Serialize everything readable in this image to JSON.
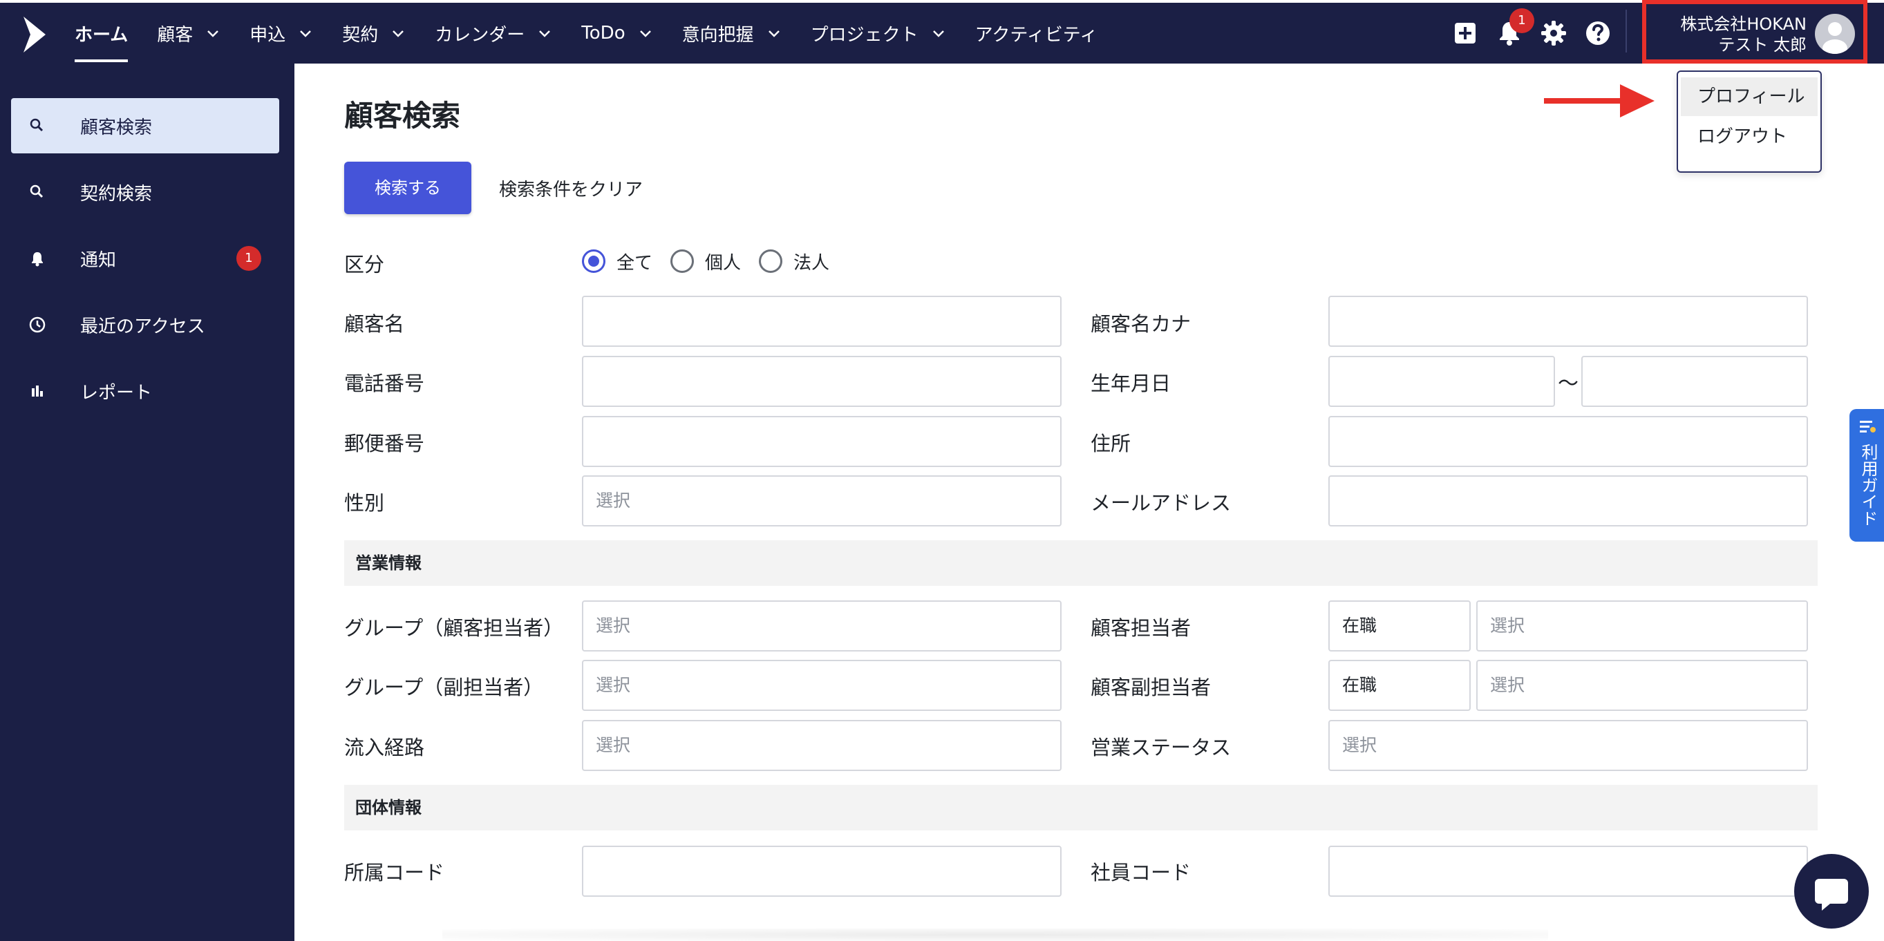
{
  "topbar": {
    "nav": [
      {
        "label": "ホーム",
        "active": true,
        "has_menu": false
      },
      {
        "label": "顧客",
        "has_menu": true
      },
      {
        "label": "申込",
        "has_menu": true
      },
      {
        "label": "契約",
        "has_menu": true
      },
      {
        "label": "カレンダー",
        "has_menu": true
      },
      {
        "label": "ToDo",
        "has_menu": true
      },
      {
        "label": "意向把握",
        "has_menu": true
      },
      {
        "label": "プロジェクト",
        "has_menu": true
      },
      {
        "label": "アクティビティ",
        "has_menu": false
      }
    ],
    "notification_count": "1",
    "account": {
      "company": "株式会社HOKAN",
      "user": "テスト 太郎"
    }
  },
  "profile_menu": {
    "items": [
      "プロフィール",
      "ログアウト"
    ]
  },
  "sidebar": {
    "items": [
      {
        "label": "顧客検索",
        "icon": "search-icon",
        "active": true
      },
      {
        "label": "契約検索",
        "icon": "search-icon"
      },
      {
        "label": "通知",
        "icon": "bell-icon",
        "badge": "1"
      },
      {
        "label": "最近のアクセス",
        "icon": "clock-icon"
      },
      {
        "label": "レポート",
        "icon": "bar-chart-icon"
      }
    ]
  },
  "main": {
    "title": "顧客検索",
    "search_button": "検索する",
    "clear_button": "検索条件をクリア",
    "category": {
      "label": "区分",
      "options": [
        "全て",
        "個人",
        "法人"
      ],
      "selected": "全て"
    },
    "fields": {
      "customer_name": "顧客名",
      "customer_name_kana": "顧客名カナ",
      "phone": "電話番号",
      "birthdate": "生年月日",
      "birthdate_sep": "〜",
      "postal_code": "郵便番号",
      "address": "住所",
      "gender": "性別",
      "email": "メールアドレス"
    },
    "placeholder_select": "選択",
    "sales_section": {
      "title": "営業情報",
      "group_main": "グループ（顧客担当者）",
      "staff_main": "顧客担当者",
      "group_sub": "グループ（副担当者）",
      "staff_sub": "顧客副担当者",
      "employment_value": "在職",
      "inflow": "流入経路",
      "sales_status": "営業ステータス"
    },
    "org_section": {
      "title": "団体情報",
      "affiliation_code": "所属コード",
      "employee_code": "社員コード"
    }
  },
  "guide_tab": "利用ガイド",
  "colors": {
    "navy": "#1b1f45",
    "primary": "#4554d9",
    "highlight": "#e8302a",
    "guide": "#2f6fe0"
  }
}
